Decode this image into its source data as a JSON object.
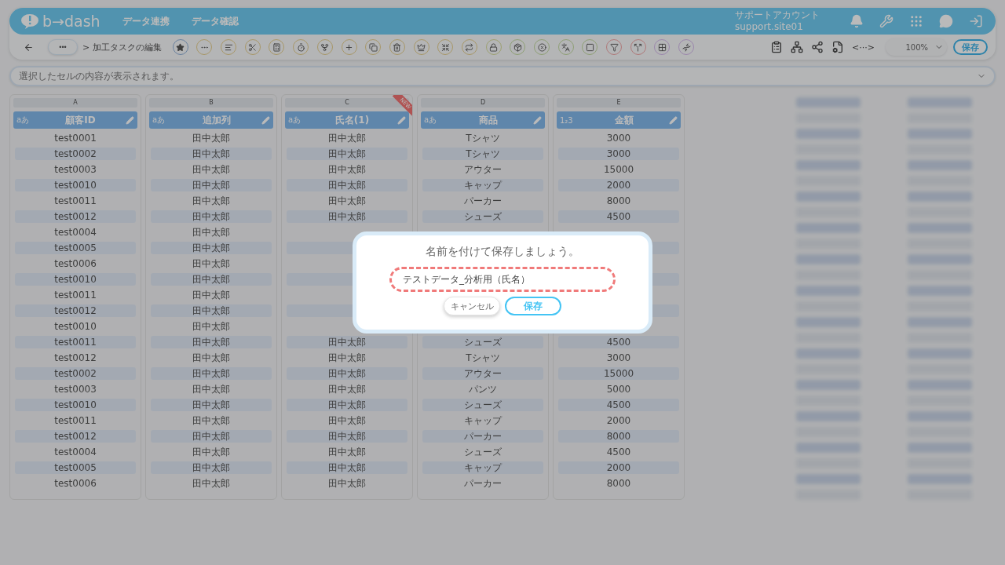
{
  "header": {
    "logo": "b→dash",
    "nav": [
      "データ連携",
      "データ確認"
    ],
    "account": {
      "name": "サポートアカウント",
      "id": "support.site01"
    }
  },
  "toolbar": {
    "more": "•••",
    "breadcrumb": "> 加工タスクの編集",
    "tools": [
      {
        "kind": "favorite"
      },
      {
        "kind": "edit"
      },
      {
        "kind": "edit"
      },
      {
        "kind": "edit"
      },
      {
        "kind": "edit"
      },
      {
        "kind": "edit"
      },
      {
        "kind": "edit"
      },
      {
        "kind": "edit"
      },
      {
        "kind": "edit"
      },
      {
        "kind": "edit"
      },
      {
        "kind": "edit"
      },
      {
        "kind": "edit"
      },
      {
        "kind": "edit"
      },
      {
        "kind": "secure"
      },
      {
        "kind": "clean"
      },
      {
        "kind": "clean"
      },
      {
        "kind": "clean"
      },
      {
        "kind": "clean"
      },
      {
        "kind": "filter"
      },
      {
        "kind": "filter"
      },
      {
        "kind": "layout"
      },
      {
        "kind": "layout"
      }
    ],
    "code": "<···>",
    "zoom": "100%",
    "save": "保存"
  },
  "formula_bar": {
    "placeholder": "選択したセルの内容が表示されます。"
  },
  "columns": [
    {
      "letter": "A",
      "type_label": "aあ",
      "name": "顧客ID",
      "cells": [
        "test0001",
        "test0002",
        "test0003",
        "test0010",
        "test0011",
        "test0012",
        "test0004",
        "test0005",
        "test0006",
        "test0010",
        "test0011",
        "test0012",
        "test0010",
        "test0011",
        "test0012",
        "test0002",
        "test0003",
        "test0010",
        "test0011",
        "test0012",
        "test0004",
        "test0005",
        "test0006"
      ]
    },
    {
      "letter": "B",
      "type_label": "aあ",
      "name": "追加列",
      "cells": [
        "田中太郎",
        "田中太郎",
        "田中太郎",
        "田中太郎",
        "田中太郎",
        "田中太郎",
        "田中太郎",
        "田中太郎",
        "田中太郎",
        "田中太郎",
        "田中太郎",
        "田中太郎",
        "田中太郎",
        "田中太郎",
        "田中太郎",
        "田中太郎",
        "田中太郎",
        "田中太郎",
        "田中太郎",
        "田中太郎",
        "田中太郎",
        "田中太郎",
        "田中太郎"
      ]
    },
    {
      "letter": "C",
      "type_label": "aあ",
      "name": "氏名(1)",
      "badge": "NEW",
      "cells": [
        "田中太郎",
        "田中太郎",
        "田中太郎",
        "田中太郎",
        "田中太郎",
        "田中太郎",
        null,
        null,
        null,
        null,
        null,
        null,
        null,
        "田中太郎",
        "田中太郎",
        "田中太郎",
        "田中太郎",
        "田中太郎",
        "田中太郎",
        "田中太郎",
        "田中太郎",
        "田中太郎",
        "田中太郎"
      ]
    },
    {
      "letter": "D",
      "type_label": "aあ",
      "name": "商品",
      "cells": [
        "Tシャツ",
        "Tシャツ",
        "アウター",
        "キャップ",
        "パーカー",
        "シューズ",
        null,
        null,
        null,
        null,
        null,
        null,
        null,
        "シューズ",
        "Tシャツ",
        "アウター",
        "パンツ",
        "シューズ",
        "キャップ",
        "パーカー",
        "シューズ",
        "キャップ",
        "パーカー"
      ]
    },
    {
      "letter": "E",
      "type_label": "1₂3",
      "name": "金額",
      "cells": [
        "3000",
        "3000",
        "15000",
        "2000",
        "8000",
        "4500",
        null,
        null,
        null,
        null,
        null,
        null,
        null,
        "4500",
        "3000",
        "15000",
        "5000",
        "4500",
        "2000",
        "8000",
        "4500",
        "2000",
        "8000"
      ]
    }
  ],
  "dialog": {
    "title": "名前を付けて保存しましょう。",
    "value": "テストデータ_分析用（氏名）",
    "highlighted": true,
    "cancel": "キャンセル",
    "save": "保存"
  }
}
